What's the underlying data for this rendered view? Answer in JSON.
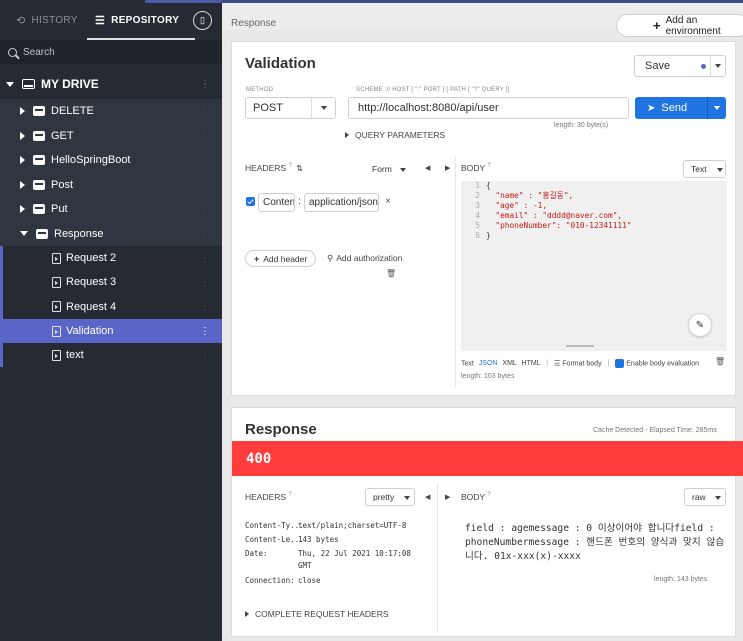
{
  "sidebar": {
    "tabs": {
      "history": "HISTORY",
      "repository": "REPOSITORY"
    },
    "search_placeholder": "Search",
    "drive": "MY DRIVE",
    "folders": [
      {
        "label": "DELETE",
        "expanded": false
      },
      {
        "label": "GET",
        "expanded": false
      },
      {
        "label": "HelloSpringBoot",
        "expanded": false
      },
      {
        "label": "Post",
        "expanded": false
      },
      {
        "label": "Put",
        "expanded": false
      },
      {
        "label": "Response",
        "expanded": true
      }
    ],
    "requests": [
      {
        "label": "Request 2",
        "active": false
      },
      {
        "label": "Request 3",
        "active": false
      },
      {
        "label": "Request 4",
        "active": false
      },
      {
        "label": "Validation",
        "active": true
      },
      {
        "label": "text",
        "active": false
      }
    ],
    "dots": "⋮"
  },
  "header": {
    "breadcrumb": "Response",
    "add_env": "Add an environment",
    "add_env_icon": "+"
  },
  "request": {
    "title": "Validation",
    "save": "Save",
    "method_label": "METHOD",
    "method": "POST",
    "url_label": "SCHEME :// HOST [ \":\" PORT ] [ PATH [ \"?\" QUERY ]]",
    "url": "http://localhost:8080/api/user",
    "url_length": "length: 30 byte(s)",
    "send": "Send",
    "query_params": "QUERY PARAMETERS",
    "headers_label": "HEADERS",
    "headers_mode": "Form",
    "header_key": "Content-Type",
    "header_value": "application/json",
    "header_remove": "×",
    "add_header": "Add header",
    "add_auth": "Add authorization",
    "body_label": "BODY",
    "body_mode": "Text",
    "body_lines": [
      {
        "n": "1",
        "text": "{"
      },
      {
        "n": "2",
        "text": "  \"name\" : \"홍길동\","
      },
      {
        "n": "3",
        "text": "  \"age\" : -1,"
      },
      {
        "n": "4",
        "text": "  \"email\" : \"dddd@naver.com\","
      },
      {
        "n": "5",
        "text": "  \"phoneNumber\": \"010-12341111\""
      },
      {
        "n": "6",
        "text": "}"
      }
    ],
    "body_formats": {
      "text": "Text",
      "json": "JSON",
      "xml": "XML",
      "html": "HTML"
    },
    "format_body": "Format body",
    "enable_eval": "Enable body evaluation",
    "body_length": "length: 103 bytes",
    "help_mark": "?"
  },
  "response": {
    "title": "Response",
    "meta": "Cache Detected - Elapsed Time: 285ms",
    "status": "400",
    "headers_label": "HEADERS",
    "headers_mode": "pretty",
    "headers": [
      {
        "key": "Content-Ty...",
        "value": "text/plain;charset=UTF-8"
      },
      {
        "key": "Content-Le...",
        "value": "143 bytes"
      },
      {
        "key": "Date:",
        "value": "Thu, 22 Jul 2021 10:17:08"
      },
      {
        "key": "",
        "value": "GMT"
      },
      {
        "key": "Connection:",
        "value": "close"
      }
    ],
    "complete_headers": "COMPLETE REQUEST HEADERS",
    "body_label": "BODY",
    "body_mode": "raw",
    "body_text": "field : agemessage : 0 이상이어야 합니다field : phoneNumbermessage : 핸드폰 번호의 양식과 맞지 않습니다. 01x-xxx(x)-xxxx",
    "body_length": "length: 143 bytes"
  },
  "colors": {
    "accent": "#1f74e2",
    "sidebar_active": "#5a66c7",
    "status_error": "#ff3d3d"
  }
}
